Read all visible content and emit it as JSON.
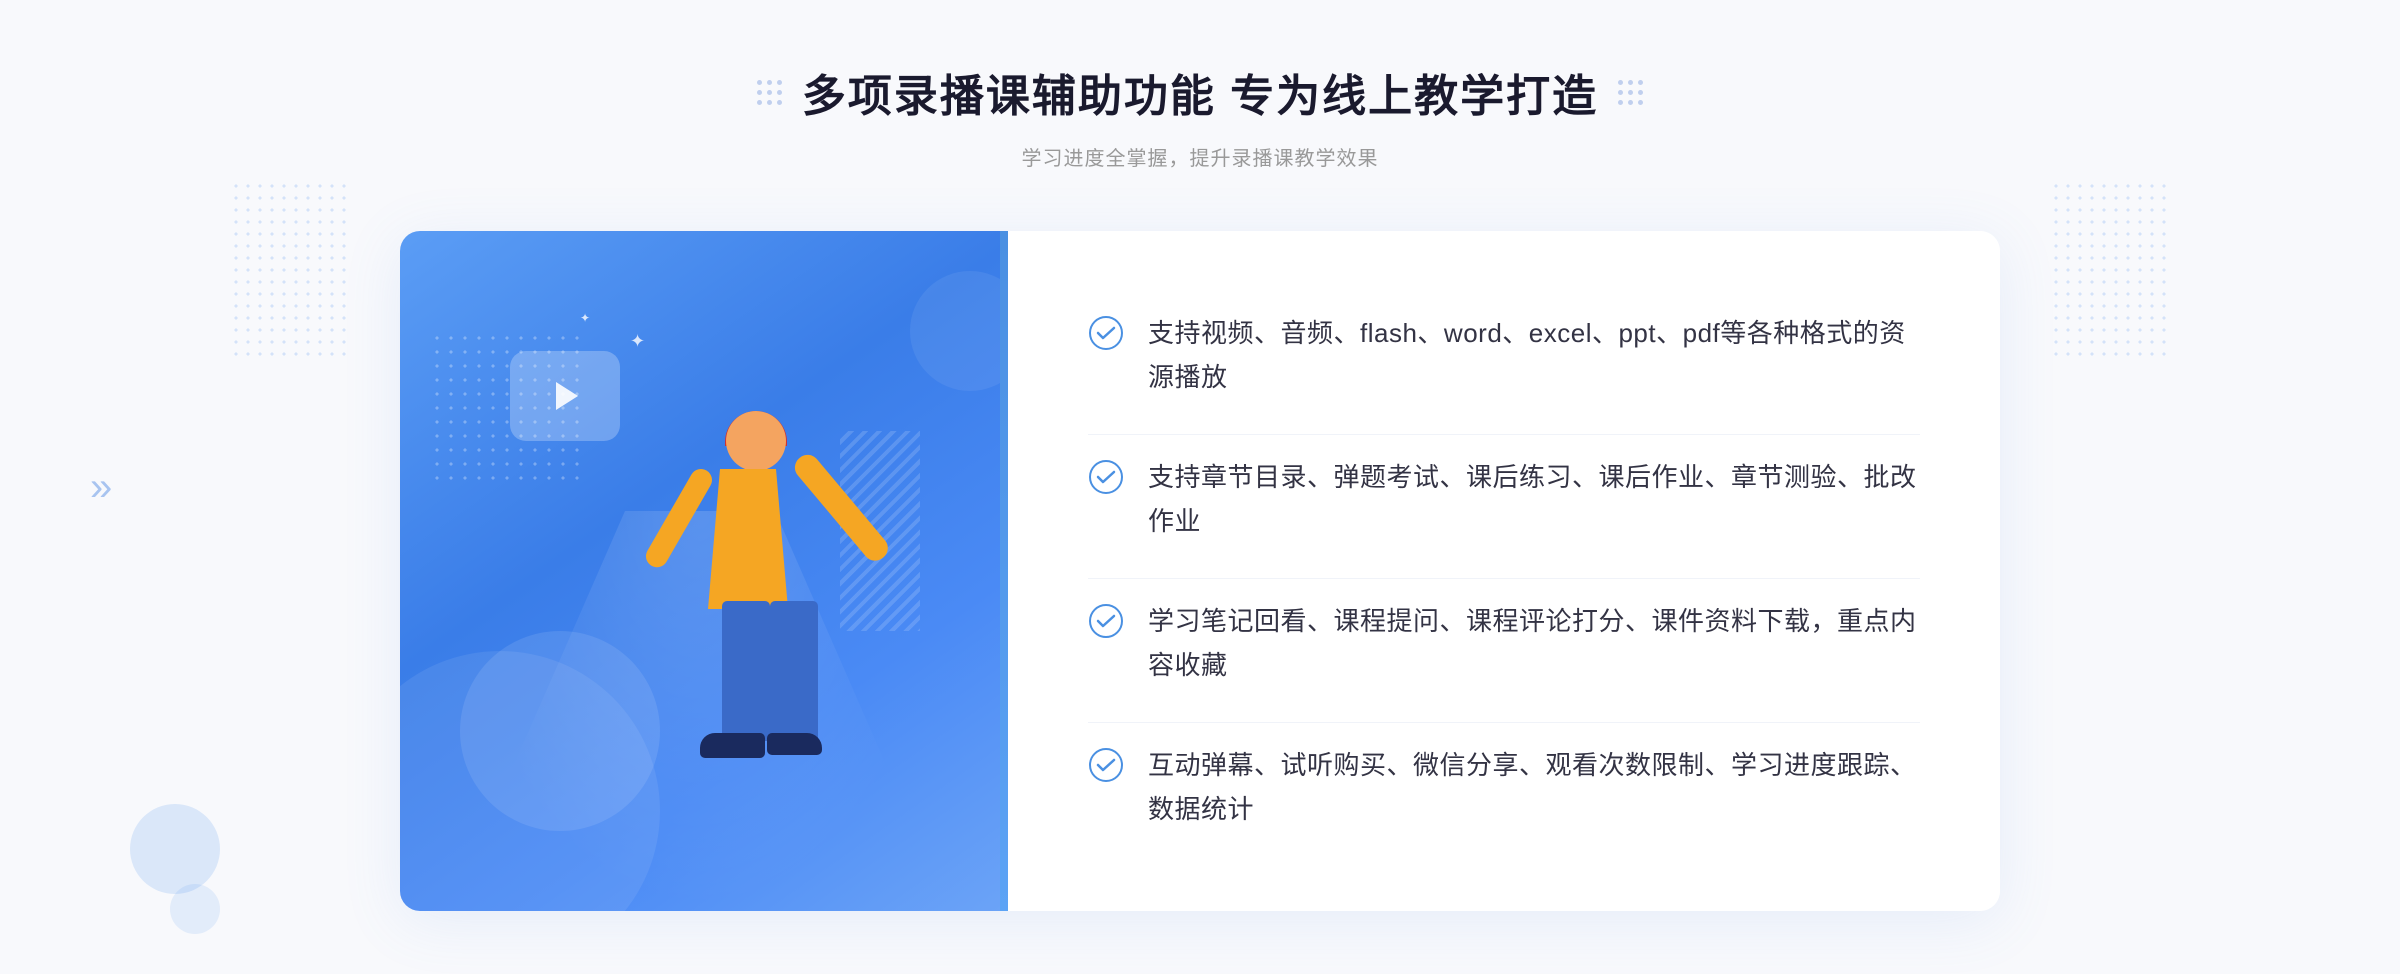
{
  "header": {
    "title": "多项录播课辅助功能 专为线上教学打造",
    "subtitle": "学习进度全掌握，提升录播课教学效果"
  },
  "features": [
    {
      "id": 1,
      "text": "支持视频、音频、flash、word、excel、ppt、pdf等各种格式的资源播放"
    },
    {
      "id": 2,
      "text": "支持章节目录、弹题考试、课后练习、课后作业、章节测验、批改作业"
    },
    {
      "id": 3,
      "text": "学习笔记回看、课程提问、课程评论打分、课件资料下载，重点内容收藏"
    },
    {
      "id": 4,
      "text": "互动弹幕、试听购买、微信分享、观看次数限制、学习进度跟踪、数据统计"
    }
  ],
  "colors": {
    "accent": "#4a90e2",
    "check": "#4a90e2",
    "title": "#1a1a2e",
    "subtitle": "#999999",
    "feature_text": "#333344"
  },
  "icons": {
    "check": "check-circle-icon",
    "dots_left": "decorative-dots-left",
    "dots_right": "decorative-dots-right"
  }
}
